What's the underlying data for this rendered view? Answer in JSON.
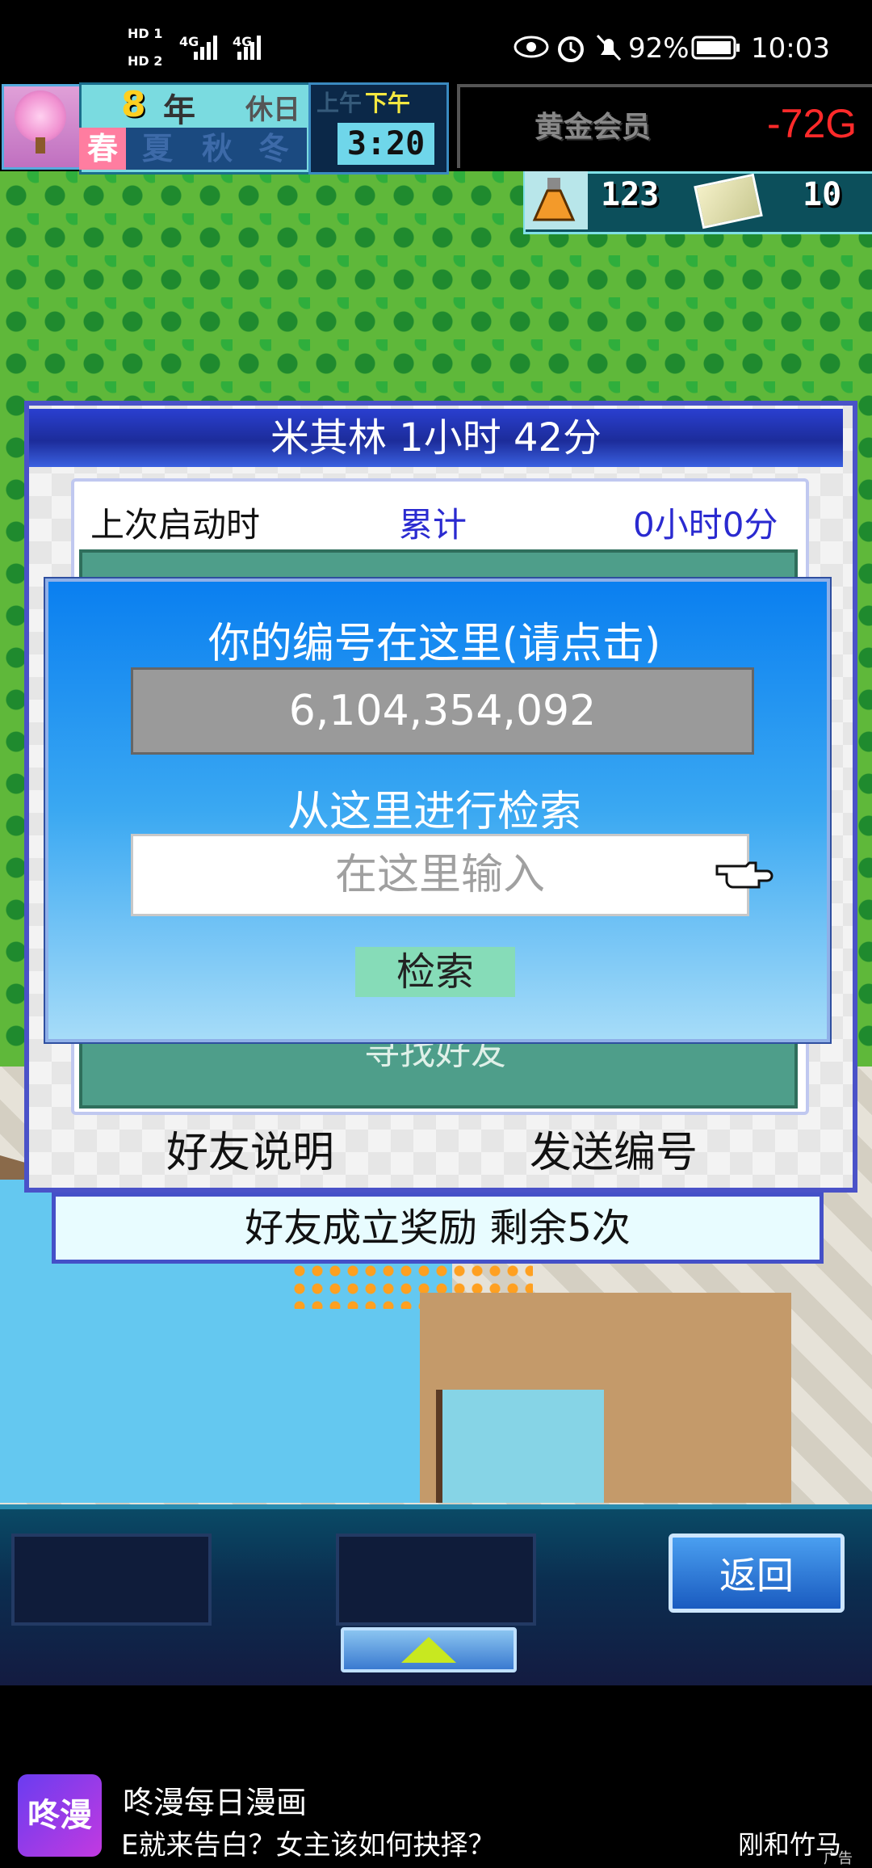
{
  "status_bar": {
    "sim1": "HD 1",
    "sim2": "HD 2",
    "net1": "4G",
    "net2": "4G",
    "battery": "92%",
    "time": "10:03"
  },
  "hud": {
    "year_number": "8",
    "year_label": "年",
    "holiday": "休日",
    "seasons": [
      "春",
      "夏",
      "秋",
      "冬"
    ],
    "active_season": "春",
    "am": "上午",
    "pm": "下午",
    "clock": "3:20",
    "membership": "黄金会员",
    "money": "-72G",
    "research_points": "123",
    "tickets": "10"
  },
  "friend_panel": {
    "title": "米其林  1小时 42分",
    "last_launch_label": "上次启动时",
    "total_label": "累计",
    "total_time": "0小时0分",
    "find_friend": "寻找好友",
    "friend_info": "好友说明",
    "send_id": "发送编号",
    "reward": "好友成立奖励  剩余5次"
  },
  "dialog": {
    "heading": "你的编号在这里(请点击)",
    "player_id": "6,104,354,092",
    "search_heading": "从这里进行检索",
    "search_placeholder": "在这里输入",
    "search_button": "检索"
  },
  "bottom_bar": {
    "back_button": "返回"
  },
  "ad": {
    "logo_text": "咚漫",
    "title": "咚漫每日漫画",
    "subtitle": "E就来告白？女主该如何抉择？",
    "right_text": "刚和竹马",
    "tag": "广告"
  }
}
